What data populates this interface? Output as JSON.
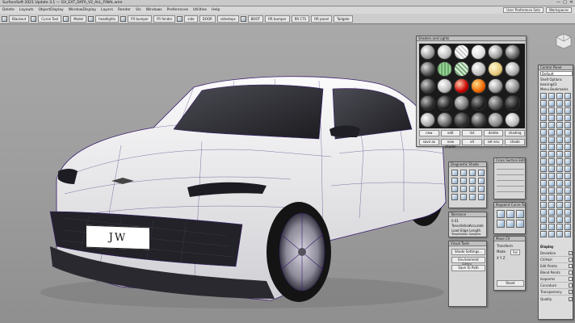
{
  "window": {
    "title": "SurfaceSoft 2021 Update 3.1 — GV_EXT_DATA_V2_ALL_FINAL.wire",
    "min": "—",
    "max": "□",
    "close": "✕"
  },
  "menu": {
    "items": [
      "Delete",
      "Layouts",
      "ObjectDisplay",
      "WindowDisplay",
      "Layers",
      "Render",
      "Vis",
      "Windows",
      "Preferences",
      "Utilities",
      "Help"
    ],
    "right_tools": [
      "User Preference Sets",
      "Workspaces"
    ]
  },
  "shelf": {
    "tabs": [
      "Blackout",
      "Curve Tool",
      "Model",
      "headlights",
      "FR bumper",
      "FR fender",
      "side",
      "DOOR",
      "sidesteps",
      "BOOT",
      "RR bumper",
      "RR CTS",
      "RR panel",
      "Tailgate"
    ]
  },
  "license_plate": {
    "text": "JW"
  },
  "shader_panel": {
    "title": "Shaders and Lights",
    "buttons_row1": [
      "new",
      "edit",
      "list",
      "delete",
      "shading"
    ],
    "buttons_row2": [
      "save as",
      "new shader",
      "all",
      "set env",
      "shade"
    ]
  },
  "diagnostic_panel": {
    "title": "Diagnostic Shade"
  },
  "tolerance_panel": {
    "title": "Tolerance",
    "value": "0.01",
    "tessellation_label": "Tessellation",
    "tessellation_value": "Accurate",
    "lb_label": "Load Edge Length",
    "ts_label": "Tessellation Samples"
  },
  "visual_panel": {
    "title": "Visual Tools",
    "buttons": [
      "Shade Settings...",
      "Environment Editor...",
      "Save To Path"
    ]
  },
  "cross_section_panel": {
    "title": "Cross Section Editor"
  },
  "curve_tools_panel": {
    "title": "Keypoint Curve Toolbox"
  },
  "move_panel": {
    "title": "Move CV",
    "transform_label": "Transform",
    "mode_label": "Mode",
    "mode_value": "Rel",
    "xyz_label": "X Y Z",
    "reset": "Reset"
  },
  "control_panel": {
    "title": "Control Panel",
    "mode": "Default",
    "palette_label": "Shelf Options",
    "bearing_label": "bearing43",
    "menu_label": "Menu Bookmarks",
    "display_section": "Display",
    "options": [
      {
        "label": "Deviation",
        "checked": true
      },
      {
        "label": "CV/Hull",
        "checked": false
      },
      {
        "label": "Edit Points",
        "checked": false
      },
      {
        "label": "Blend Points",
        "checked": false
      },
      {
        "label": "Isoparms",
        "checked": false
      },
      {
        "label": "Curvature",
        "checked": false
      },
      {
        "label": "Transparency",
        "checked": true
      },
      {
        "label": "Quality",
        "checked": true
      }
    ]
  },
  "colors": {
    "body": "#f2f2f2",
    "wire": "#3b1e6e",
    "glass": "#2a2a2e",
    "tire": "#141414",
    "rim": "#9a98a3",
    "panel_bg": "#d6d6d6"
  },
  "icons": {
    "camera": "view-cube-icon",
    "min": "minimize-icon",
    "close": "close-icon"
  }
}
